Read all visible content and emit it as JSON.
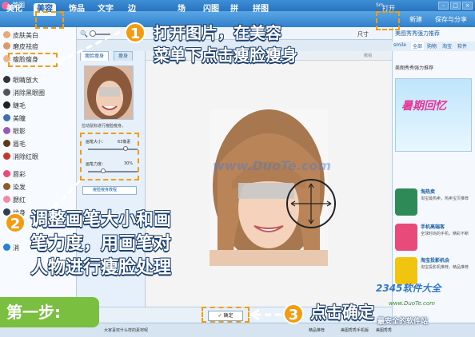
{
  "window": {
    "title": "美图",
    "title_tail": "Sm",
    "controls": [
      "-",
      "□",
      "×"
    ]
  },
  "menu": {
    "tabs": [
      "美化",
      "美容",
      "饰品",
      "文字",
      "边",
      "场",
      "闪图",
      "拼",
      "拼图"
    ],
    "active_tab": "美容",
    "open_label": "打开",
    "new_label": "新建",
    "save_label": "保存与分享"
  },
  "toolbar": {
    "size_label": "尺寸"
  },
  "sidebar": {
    "items": [
      {
        "label": "皮肤美白",
        "color": "#e8a97a"
      },
      {
        "label": "磨皮祛痘",
        "color": "#d99a6c"
      },
      {
        "label": "瘦脸瘦身",
        "color": "#f0b48a"
      },
      {
        "label": "眼睛放大",
        "color": "#333333"
      },
      {
        "label": "消除黑眼圈",
        "color": "#555555"
      },
      {
        "label": "睫毛",
        "color": "#222222"
      },
      {
        "label": "美瞳",
        "color": "#3a6fb0"
      },
      {
        "label": "眼影",
        "color": "#9b59b6"
      },
      {
        "label": "眉毛",
        "color": "#5b3b1f"
      },
      {
        "label": "消除红眼",
        "color": "#c0392b"
      },
      {
        "label": "唇彩",
        "color": "#e84a7a"
      },
      {
        "label": "染发",
        "color": "#8e5a2a"
      },
      {
        "label": "腮红",
        "color": "#f08aa8"
      },
      {
        "label": "纹身",
        "color": "#2c3e50"
      },
      {
        "label": "消",
        "color": "#2a7fd0"
      }
    ]
  },
  "panel": {
    "tabs": [
      "瘦脸瘦身",
      "瘦身"
    ],
    "hint": "拉动鼠标进行瘦脸瘦身。",
    "brush_size_label": "画笔大小：",
    "brush_size_value": "63像素",
    "brush_size_fraction": 0.75,
    "brush_force_label": "画笔力度：",
    "brush_force_value": "30%",
    "brush_force_fraction": 0.3,
    "tutorial_label": "瘦脸瘦身教程",
    "undo_label": "撤销"
  },
  "canvas": {
    "watermark": "www.DuoTe.com"
  },
  "bottom": {
    "confirm_label": "确定",
    "status_items": [
      "大家喜欢什么样的素材呢",
      "精品推荐",
      "美图秀秀手机版",
      "美图秀秀"
    ]
  },
  "right_panel": {
    "header": "美图秀秀强力推荐",
    "tabs": [
      "smile",
      "全部",
      "购物",
      "淘宝",
      "软件"
    ],
    "active_tab": "全部",
    "sub_header": "美图秀秀强力推荐",
    "banner_text": "暑期回忆",
    "items": [
      {
        "title": "淘热卖",
        "desc": "淘宝最热卖，热卖宝贝推荐",
        "color": "#2e8b57"
      },
      {
        "title": "手机高端客",
        "desc": "全球时尚的手机，精彩不断",
        "color": "#e84a7a"
      },
      {
        "title": "淘宝投影机会",
        "desc": "淘宝投影机推荐，精品推荐",
        "color": "#f1c40f"
      }
    ],
    "footer": "手机"
  },
  "overlays": {
    "step1_num": "1",
    "step1_text_line1": "打开图片，在美容",
    "step1_text_line2": "菜单下点击瘦脸瘦身",
    "step2_num": "2",
    "step2_text_line1": "调整画笔大小和画",
    "step2_text_line2": "笔力度，用画笔对",
    "step2_text_line3": "人物进行瘦脸处理",
    "step3_num": "3",
    "step3_text": "点击确定",
    "first_step": "第一步:",
    "site_badge": "2345软件大全",
    "site_url": "www.DuoTe.com",
    "site_slogan": "最安全的软件站"
  },
  "colors": {
    "accent": "#f39c12",
    "brand_blue": "#2f7fcb",
    "step_green": "#7abf3f"
  }
}
